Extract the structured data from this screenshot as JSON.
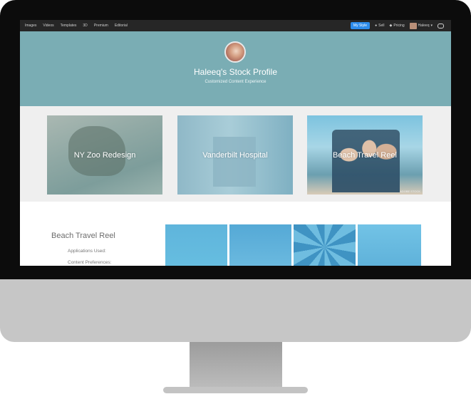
{
  "nav": {
    "links": [
      "Images",
      "Videos",
      "Templates",
      "3D",
      "Premium",
      "Editorial"
    ],
    "my_style_label": "My Style",
    "sell_label": "Sell",
    "pricing_label": "Pricing",
    "user_label": "Haleeq",
    "accent_color": "#2d8ceb"
  },
  "profile": {
    "title": "Haleeq's Stock Profile",
    "subtitle": "Customized Content Experience",
    "banner_color": "#7aadb4"
  },
  "gallery": {
    "cards": [
      {
        "label": "NY Zoo Redesign"
      },
      {
        "label": "Vanderbilt Hospital"
      },
      {
        "label": "Beach Travel Reel",
        "watermark": "ADOBE STOCK"
      }
    ]
  },
  "reel": {
    "title": "Beach Travel Reel",
    "applications_label": "Applications Used:",
    "preferences_label": "Content Preferences:"
  }
}
